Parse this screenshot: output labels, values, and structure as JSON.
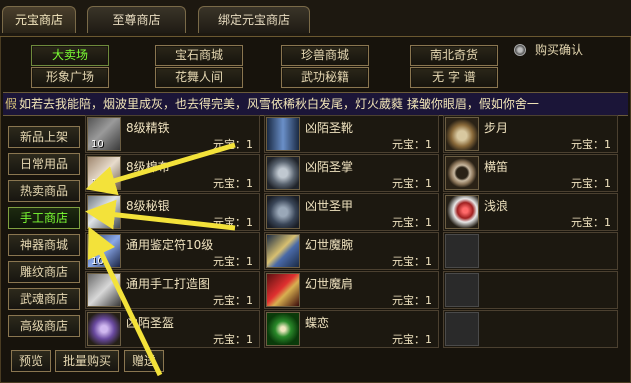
{
  "tabs": [
    "元宝商店",
    "至尊商店",
    "绑定元宝商店"
  ],
  "categories": [
    [
      "大卖场",
      "宝石商城",
      "珍兽商城",
      "南北奇货"
    ],
    [
      "形象广场",
      "花舞人间",
      "武功秘籍",
      "无 字 谱"
    ]
  ],
  "confirm_label": "购买确认",
  "marquee": {
    "cap": "假",
    "text": "如若去我能陪，烟波里成灰，也去得完美，风雪依稀秋白发尾，灯火葳蕤 揉皱你眼眉，假如你舍一"
  },
  "sidebar": [
    "新品上架",
    "日常用品",
    "热卖商品",
    "手工商店",
    "神器商城",
    "雕纹商店",
    "武魂商店",
    "高级商店"
  ],
  "price_label": "元宝：1",
  "items": [
    [
      {
        "name": "8级精铁",
        "count": "10"
      },
      {
        "name": "凶陌圣靴"
      },
      {
        "name": "步月"
      }
    ],
    [
      {
        "name": "8级棉布",
        "count": "10"
      },
      {
        "name": "凶陌圣掌"
      },
      {
        "name": "横笛"
      }
    ],
    [
      {
        "name": "8级秘银",
        "count": ""
      },
      {
        "name": "凶世圣甲"
      },
      {
        "name": "浅浪"
      }
    ],
    [
      {
        "name": "通用鉴定符10级",
        "count": "10"
      },
      {
        "name": "幻世魔腕"
      },
      null
    ],
    [
      {
        "name": "通用手工打造图",
        "count": ""
      },
      {
        "name": "幻世魔肩"
      },
      null
    ],
    [
      {
        "name": "凶陌圣盔",
        "count": ""
      },
      {
        "name": "蝶恋"
      },
      null
    ]
  ],
  "bottom_buttons": [
    "预览",
    "批量购买",
    "赠送"
  ]
}
